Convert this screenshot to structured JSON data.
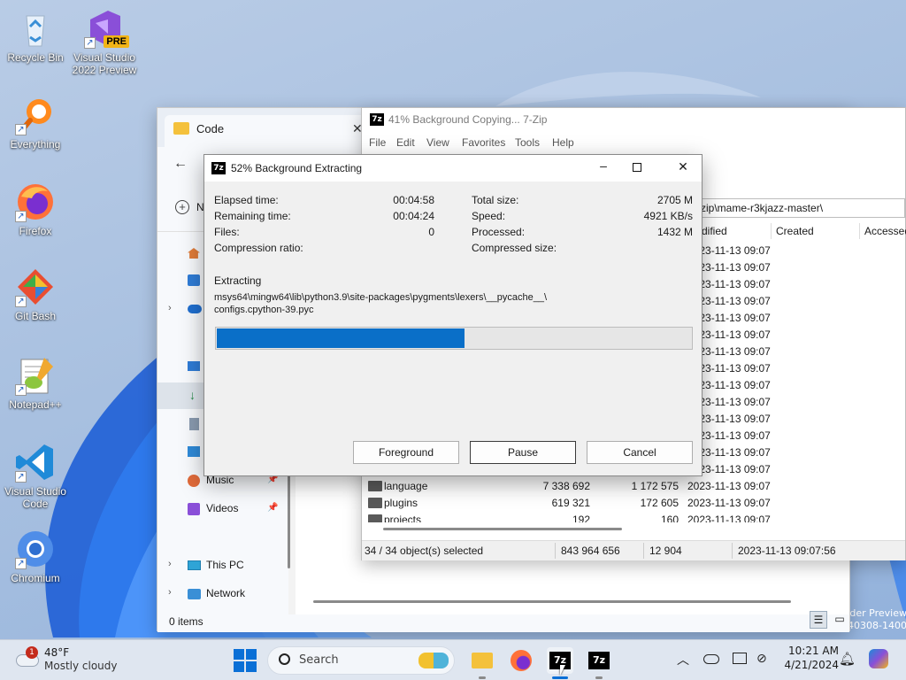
{
  "desktop": {
    "icons": [
      {
        "label": "Recycle Bin",
        "icon": "recycle-bin-icon"
      },
      {
        "label": "Visual Studio 2022 Preview",
        "icon": "visual-studio-preview-icon",
        "badge": "PRE"
      },
      {
        "label": "Everything",
        "icon": "everything-search-icon"
      },
      {
        "label": "Firefox",
        "icon": "firefox-icon"
      },
      {
        "label": "Git Bash",
        "icon": "git-bash-icon"
      },
      {
        "label": "Notepad++",
        "icon": "notepadpp-icon"
      },
      {
        "label": "Visual Studio Code",
        "icon": "vscode-icon"
      },
      {
        "label": "Chromium",
        "icon": "chromium-icon"
      }
    ],
    "watermark": {
      "line1": "der Preview",
      "line2": "40308-1400"
    }
  },
  "explorer": {
    "title": "Code",
    "new_label": "N",
    "nav": [
      {
        "label": "Music",
        "icon": "music-icon"
      },
      {
        "label": "Videos",
        "icon": "videos-icon"
      },
      {
        "label": "This PC",
        "icon": "this-pc-icon"
      },
      {
        "label": "Network",
        "icon": "network-icon"
      }
    ],
    "status": "0 items"
  },
  "sevenzip": {
    "title": "41% Background Copying... 7-Zip",
    "menu": [
      "File",
      "Edit",
      "View",
      "Favorites",
      "Tools",
      "Help"
    ],
    "path": "zip\\mame-r3kjazz-master\\",
    "columns": [
      "dified",
      "Created",
      "Accessed"
    ],
    "dates": [
      "2023-11-13 09:07",
      "2023-11-13 09:07",
      "2023-11-13 09:07",
      "2023-11-13 09:07",
      "2023-11-13 09:07",
      "2023-11-13 09:07",
      "2023-11-13 09:07",
      "2023-11-13 09:07",
      "2023-11-13 09:07",
      "2023-11-13 09:07",
      "2023-11-13 09:07",
      "2023-11-13 09:07",
      "2023-11-13 09:07",
      "2023-11-13 09:07"
    ],
    "files": [
      {
        "name": "language",
        "size": "7 338 692",
        "packed": "1 172 575",
        "modified": "2023-11-13 09:07"
      },
      {
        "name": "plugins",
        "size": "619 321",
        "packed": "172 605",
        "modified": "2023-11-13 09:07"
      },
      {
        "name": "projects",
        "size": "192",
        "packed": "160",
        "modified": "2023-11-13 09:07"
      }
    ],
    "status": {
      "selected": "34 / 34 object(s) selected",
      "size": "843 964 656",
      "packed": "12 904",
      "date": "2023-11-13 09:07:56"
    }
  },
  "dialog": {
    "title": "52% Background Extracting",
    "left": [
      {
        "label": "Elapsed time:",
        "value": "00:04:58"
      },
      {
        "label": "Remaining time:",
        "value": "00:04:24"
      },
      {
        "label": "Files:",
        "value": "0"
      },
      {
        "label": "Compression ratio:",
        "value": ""
      }
    ],
    "right": [
      {
        "label": "Total size:",
        "value": "2705 M"
      },
      {
        "label": "Speed:",
        "value": "4921 KB/s"
      },
      {
        "label": "Processed:",
        "value": "1432 M"
      },
      {
        "label": "Compressed size:",
        "value": ""
      }
    ],
    "operation": "Extracting",
    "file_line1": "msys64\\mingw64\\lib\\python3.9\\site-packages\\pygments\\lexers\\__pycache__\\",
    "file_line2": "configs.cpython-39.pyc",
    "progress": 0.52,
    "buttons": {
      "foreground": "Foreground",
      "pause": "Pause",
      "cancel": "Cancel"
    }
  },
  "taskbar": {
    "weather": {
      "temp": "48°F",
      "desc": "Mostly cloudy",
      "badge": "1"
    },
    "search": "Search",
    "time": "10:21 AM",
    "date": "4/21/2024",
    "sevenzip_label": "7z"
  }
}
